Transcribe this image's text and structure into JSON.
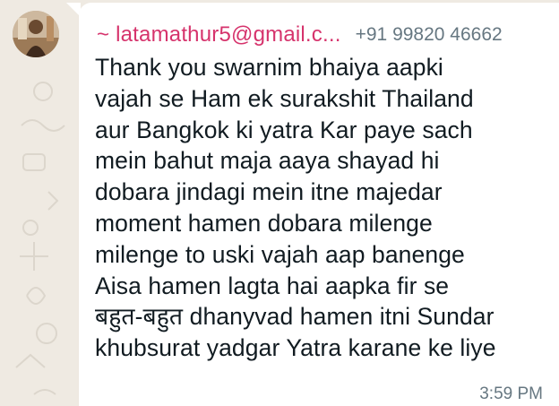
{
  "chat": {
    "sender_name": "~ latamathur5@gmail.c...",
    "sender_phone": "+91 99820 46662",
    "message_text": "Thank you swarnim  bhaiya aapki\nvajah se Ham ek surakshit Thailand\naur Bangkok ki yatra Kar paye sach\nmein bahut maja aaya shayad hi\ndobara jindagi mein itne majedar\nmoment hamen dobara milenge\nmilenge to uski vajah aap banenge\nAisa hamen lagta hai aapka fir se\nबहुत-बहुत dhanyvad hamen itni Sundar\nkhubsurat yadgar Yatra karane ke liye",
    "timestamp": "3:59 PM"
  },
  "colors": {
    "wallpaper": "#efeae2",
    "bubble": "#ffffff",
    "sender_name": "#d6336c",
    "meta_text": "#667781",
    "message_text": "#111b21"
  },
  "icons": {
    "avatar": "user-avatar-photo"
  }
}
